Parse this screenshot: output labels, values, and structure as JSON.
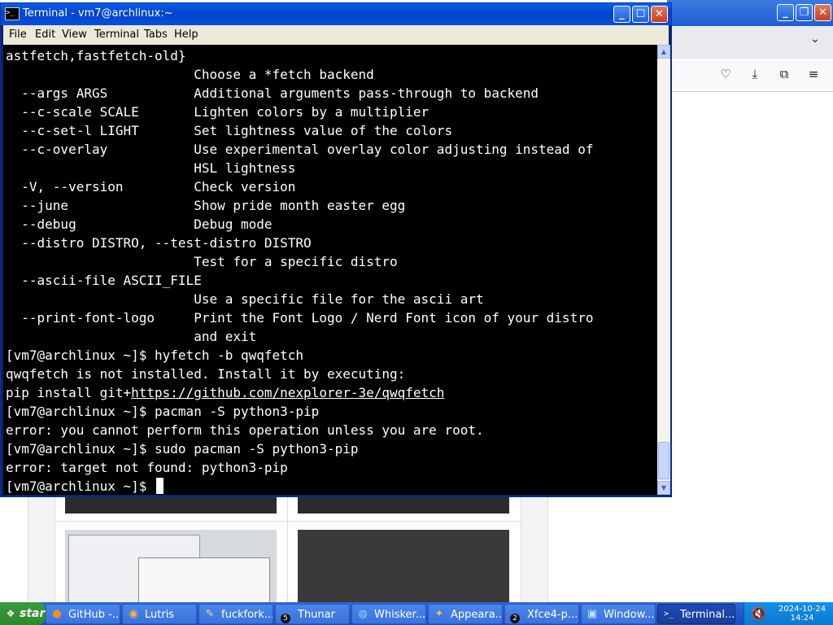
{
  "browser": {
    "toolbar_icons": [
      "pocket-icon",
      "download-icon",
      "extensions-icon",
      "menu-icon"
    ]
  },
  "terminal": {
    "title": "Terminal - vm7@archlinux:~",
    "menu": [
      "File",
      "Edit",
      "View",
      "Terminal",
      "Tabs",
      "Help"
    ],
    "lines": [
      "astfetch,fastfetch-old}",
      "                        Choose a *fetch backend",
      "  --args ARGS           Additional arguments pass-through to backend",
      "  --c-scale SCALE       Lighten colors by a multiplier",
      "  --c-set-l LIGHT       Set lightness value of the colors",
      "  --c-overlay           Use experimental overlay color adjusting instead of",
      "                        HSL lightness",
      "  -V, --version         Check version",
      "  --june                Show pride month easter egg",
      "  --debug               Debug mode",
      "  --distro DISTRO, --test-distro DISTRO",
      "                        Test for a specific distro",
      "  --ascii-file ASCII_FILE",
      "                        Use a specific file for the ascii art",
      "  --print-font-logo     Print the Font Logo / Nerd Font icon of your distro",
      "                        and exit",
      "[vm7@archlinux ~]$ hyfetch -b qwqfetch",
      "qwqfetch is not installed. Install it by executing:",
      "pip install git+",
      "[vm7@archlinux ~]$ pacman -S python3-pip",
      "error: you cannot perform this operation unless you are root.",
      "[vm7@archlinux ~]$ sudo pacman -S python3-pip",
      "error: target not found: python3-pip",
      "[vm7@archlinux ~]$ "
    ],
    "link": "https://github.com/nexplorer-3e/qwqfetch"
  },
  "taskbar": {
    "start_label": "start",
    "buttons": [
      {
        "label": "GitHub -...",
        "icon": "firefox-icon"
      },
      {
        "label": "Lutris",
        "icon": "lutris-icon"
      },
      {
        "label": "fuckfork...",
        "icon": "mousepad-icon"
      },
      {
        "label": "Thunar",
        "icon": "folder-icon",
        "badge": "5"
      },
      {
        "label": "Whisker...",
        "icon": "whisker-icon"
      },
      {
        "label": "Appeara...",
        "icon": "appearance-icon"
      },
      {
        "label": "Xfce4-p...",
        "icon": "xfce-panel-icon",
        "badge": "2"
      },
      {
        "label": "Window...",
        "icon": "window-manager-icon"
      },
      {
        "label": "Terminal...",
        "icon": "terminal-icon",
        "active": true
      }
    ],
    "clock_date": "2024-10-24",
    "clock_time": "14:24"
  }
}
